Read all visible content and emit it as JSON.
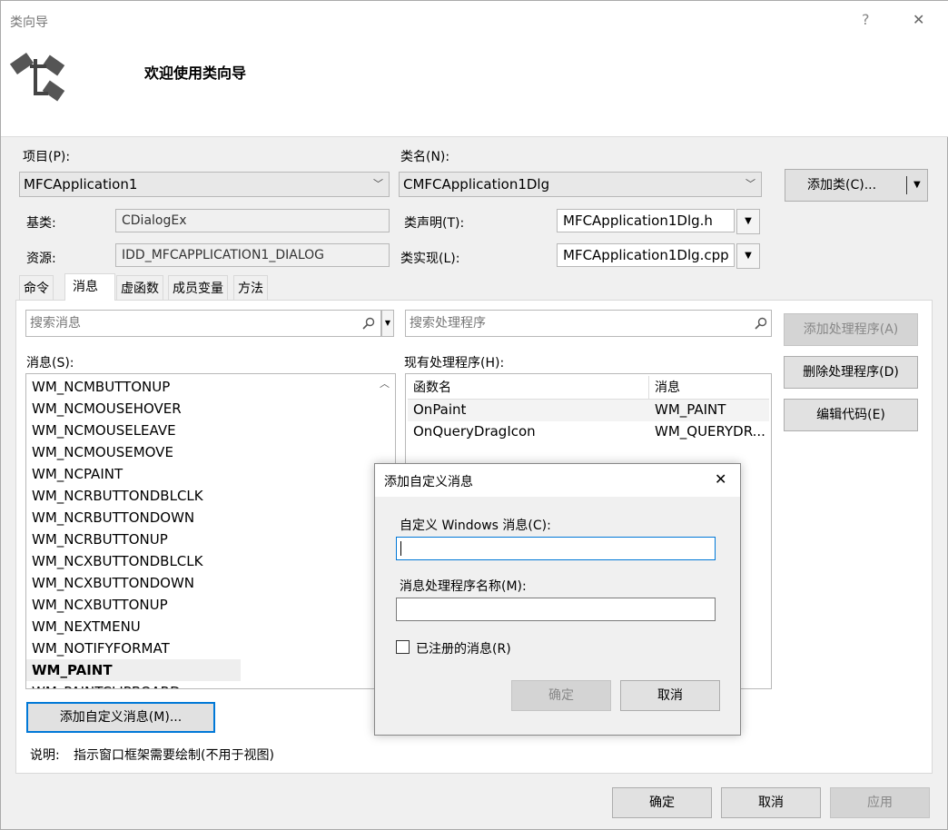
{
  "window": {
    "title": "类向导",
    "help_glyph": "?",
    "close_glyph": "✕"
  },
  "header": {
    "welcome": "欢迎使用类向导"
  },
  "project": {
    "label": "项目(P):",
    "value": "MFCApplication1"
  },
  "classname": {
    "label": "类名(N):",
    "value": "CMFCApplication1Dlg"
  },
  "add_class_button": "添加类(C)...",
  "base": {
    "label": "基类:",
    "value": "CDialogEx"
  },
  "resource": {
    "label": "资源:",
    "value": "IDD_MFCAPPLICATION1_DIALOG"
  },
  "class_decl": {
    "label": "类声明(T):",
    "value": "MFCApplication1Dlg.h"
  },
  "class_impl": {
    "label": "类实现(L):",
    "value": "MFCApplication1Dlg.cpp"
  },
  "tabs": [
    {
      "label": "命令"
    },
    {
      "label": "消息"
    },
    {
      "label": "虚函数"
    },
    {
      "label": "成员变量"
    },
    {
      "label": "方法"
    }
  ],
  "search_messages_placeholder": "搜索消息",
  "search_handlers_placeholder": "搜索处理程序",
  "messages": {
    "label": "消息(S):",
    "items": [
      "WM_NCMBUTTONUP",
      "WM_NCMOUSEHOVER",
      "WM_NCMOUSELEAVE",
      "WM_NCMOUSEMOVE",
      "WM_NCPAINT",
      "WM_NCRBUTTONDBLCLK",
      "WM_NCRBUTTONDOWN",
      "WM_NCRBUTTONUP",
      "WM_NCXBUTTONDBLCLK",
      "WM_NCXBUTTONDOWN",
      "WM_NCXBUTTONUP",
      "WM_NEXTMENU",
      "WM_NOTIFYFORMAT",
      "WM_PAINT",
      "WM_PAINTCLIPBOARD"
    ],
    "selected": "WM_PAINT"
  },
  "handlers": {
    "label": "现有处理程序(H):",
    "columns": [
      "函数名",
      "消息"
    ],
    "rows": [
      [
        "OnPaint",
        "WM_PAINT"
      ],
      [
        "OnQueryDragIcon",
        "WM_QUERYDR..."
      ]
    ]
  },
  "buttons": {
    "add_handler": "添加处理程序(A)",
    "delete_handler": "删除处理程序(D)",
    "edit_code": "编辑代码(E)",
    "add_custom_message": "添加自定义消息(M)...",
    "ok": "确定",
    "cancel": "取消",
    "apply": "应用"
  },
  "description": {
    "label": "说明:",
    "text": "指示窗口框架需要绘制(不用于视图)"
  },
  "dialog": {
    "title": "添加自定义消息",
    "custom_msg_label": "自定义 Windows 消息(C):",
    "custom_msg_value": "",
    "handler_name_label": "消息处理程序名称(M):",
    "handler_name_value": "",
    "registered_label": "已注册的消息(R)",
    "registered_checked": false,
    "ok": "确定",
    "cancel": "取消"
  }
}
